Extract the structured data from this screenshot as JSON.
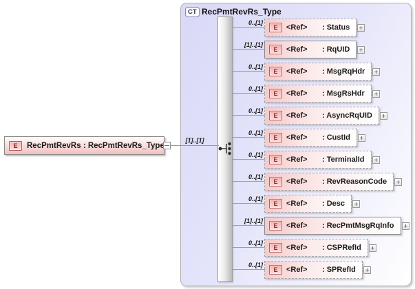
{
  "root_element": {
    "icon_letter": "E",
    "label": "RecPmtRevRs : RecPmtRevRs_Type",
    "connection_cardinality": "[1]..[1]"
  },
  "complex_type": {
    "badge": "CT",
    "title": "RecPmtRevRs_Type",
    "compositor": "sequence",
    "children": [
      {
        "icon_letter": "E",
        "ref": "<Ref>",
        "name": ": Status",
        "cardinality": "0..[1]",
        "required": false
      },
      {
        "icon_letter": "E",
        "ref": "<Ref>",
        "name": ": RqUID",
        "cardinality": "[1]..[1]",
        "required": true
      },
      {
        "icon_letter": "E",
        "ref": "<Ref>",
        "name": ": MsgRqHdr",
        "cardinality": "0..[1]",
        "required": false
      },
      {
        "icon_letter": "E",
        "ref": "<Ref>",
        "name": ": MsgRsHdr",
        "cardinality": "0..[1]",
        "required": false
      },
      {
        "icon_letter": "E",
        "ref": "<Ref>",
        "name": ": AsyncRqUID",
        "cardinality": "0..[1]",
        "required": false
      },
      {
        "icon_letter": "E",
        "ref": "<Ref>",
        "name": ": CustId",
        "cardinality": "0..[1]",
        "required": false
      },
      {
        "icon_letter": "E",
        "ref": "<Ref>",
        "name": ": TerminalId",
        "cardinality": "0..[1]",
        "required": false
      },
      {
        "icon_letter": "E",
        "ref": "<Ref>",
        "name": ": RevReasonCode",
        "cardinality": "0..[1]",
        "required": false
      },
      {
        "icon_letter": "E",
        "ref": "<Ref>",
        "name": ": Desc",
        "cardinality": "0..[1]",
        "required": false
      },
      {
        "icon_letter": "E",
        "ref": "<Ref>",
        "name": ": RecPmtMsgRqInfo",
        "cardinality": "[1]..[1]",
        "required": true
      },
      {
        "icon_letter": "E",
        "ref": "<Ref>",
        "name": ": CSPRefId",
        "cardinality": "0..[1]",
        "required": false
      },
      {
        "icon_letter": "E",
        "ref": "<Ref>",
        "name": ": SPRefId",
        "cardinality": "0..[1]",
        "required": false
      }
    ]
  },
  "colors": {
    "container_fill": "#dcdcfa",
    "element_fill": "#f5c6c6",
    "line_border": "#999999",
    "e_icon_border": "#b25a5a",
    "e_icon_text": "#8b2525",
    "ct_badge_border": "#8282b8"
  }
}
